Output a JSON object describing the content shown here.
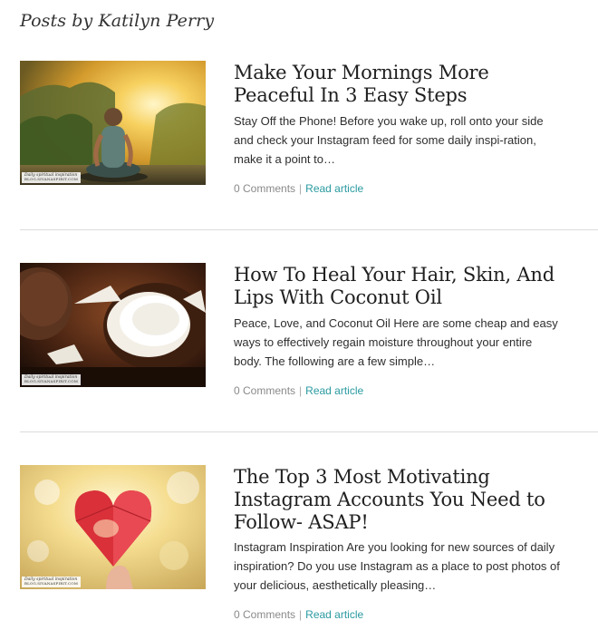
{
  "page": {
    "heading": "Posts by Katilyn Perry"
  },
  "watermark": {
    "line1": "Daily spiritual inspiration",
    "line2": "BLOG.SIVANASPIRIT.COM"
  },
  "posts": [
    {
      "title": "Make Your Mornings More Peaceful In 3 Easy Steps",
      "excerpt": "Stay Off the Phone! Before you wake up, roll onto your side and check your Instagram feed for some daily inspi-ration, make it a point to…",
      "comments": "0 Comments",
      "separator": "|",
      "read_label": "Read article",
      "image_icon": "meditation-sunset-image"
    },
    {
      "title": "How To Heal Your Hair, Skin, And Lips With Coconut Oil",
      "excerpt": "Peace, Love, and Coconut Oil Here are some cheap and easy ways to effectively regain moisture throughout your entire body. The following are a few simple…",
      "comments": "0 Comments",
      "separator": "|",
      "read_label": "Read article",
      "image_icon": "coconut-image"
    },
    {
      "title": "The Top 3 Most Motivating Instagram Accounts You Need to Follow- ASAP!",
      "excerpt": "Instagram Inspiration Are you looking for new sources of daily inspiration? Do you use Instagram as a place to post photos of your delicious, aesthetically pleasing…",
      "comments": "0 Comments",
      "separator": "|",
      "read_label": "Read article",
      "image_icon": "paper-heart-image"
    }
  ],
  "colors": {
    "link": "#2a9aa0",
    "meta": "#888888",
    "divider": "#dcdcdc"
  }
}
